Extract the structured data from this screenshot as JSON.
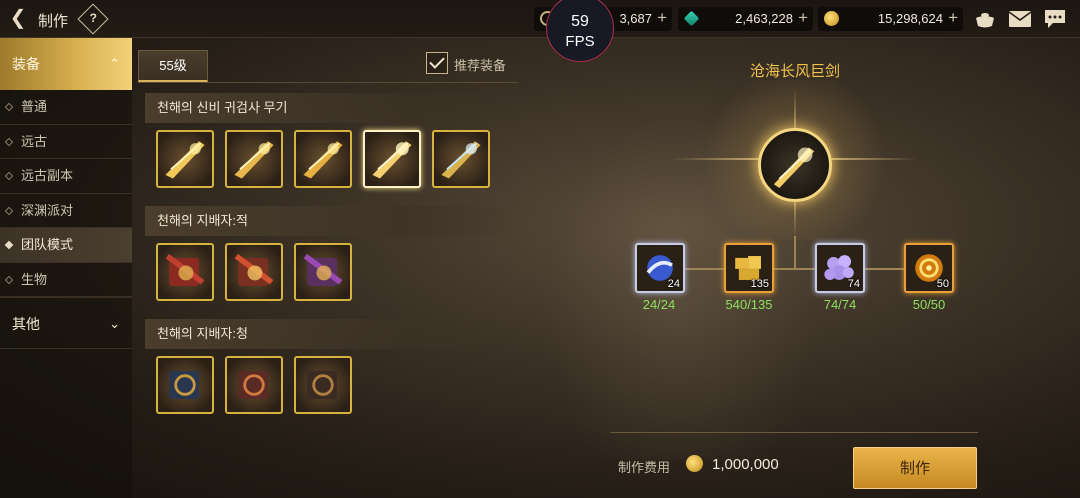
{
  "header": {
    "title": "制作",
    "help_label": "?",
    "currencies": [
      {
        "icon": "ring-currency-icon",
        "value": "3,687"
      },
      {
        "icon": "gem-currency-icon",
        "value": "2,463,228"
      },
      {
        "icon": "gold-coin-icon",
        "value": "15,298,624"
      }
    ],
    "plus_label": "+",
    "fps": {
      "value": "59",
      "label": "FPS"
    },
    "icons": [
      "pot-icon",
      "mail-icon",
      "chat-icon"
    ]
  },
  "sidebar": {
    "category_equip": "装备",
    "items": [
      {
        "label": "普通",
        "active": false
      },
      {
        "label": "远古",
        "active": false
      },
      {
        "label": "远古副本",
        "active": false
      },
      {
        "label": "深渊派对",
        "active": false
      },
      {
        "label": "团队模式",
        "active": true
      },
      {
        "label": "生物",
        "active": false
      }
    ],
    "category_other": "其他"
  },
  "level_tab": "55级",
  "recommend": {
    "label": "推荐装备",
    "checked": true
  },
  "groups": [
    {
      "title": "천해의 신비 귀검사 무기",
      "slot_count": 5,
      "selected_index": 3
    },
    {
      "title": "천해의 지배자:적",
      "slot_count": 3
    },
    {
      "title": "천해의 지배자:청",
      "slot_count": 3
    }
  ],
  "detail": {
    "item_name": "沧海长风巨剑",
    "materials": [
      {
        "icon": "blue-orb-material-icon",
        "stack": "24",
        "progress": "24/24"
      },
      {
        "icon": "gold-cube-material-icon",
        "stack": "135",
        "progress": "540/135"
      },
      {
        "icon": "purple-crystal-material-icon",
        "stack": "74",
        "progress": "74/74"
      },
      {
        "icon": "fire-core-material-icon",
        "stack": "50",
        "progress": "50/50"
      }
    ],
    "cost_label": "制作费用",
    "cost_value": "1,000,000",
    "craft_button": "制作"
  },
  "colors": {
    "accent_gold": "#d7b23c",
    "progress_green": "#8fe060",
    "item_name": "#f0c24c"
  }
}
